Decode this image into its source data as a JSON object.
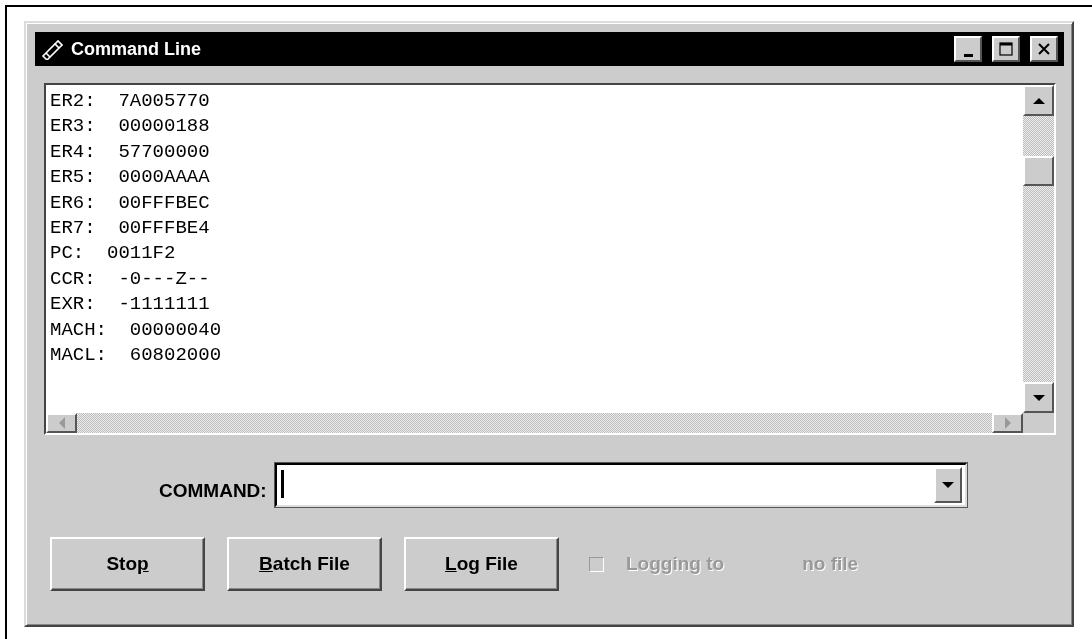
{
  "window": {
    "title": "Command Line"
  },
  "output": {
    "lines": [
      "ER2:  7A005770",
      "ER3:  00000188",
      "ER4:  57700000",
      "ER5:  0000AAAA",
      "ER6:  00FFFBEC",
      "ER7:  00FFFBE4",
      "PC:  0011F2",
      "CCR:  -0---Z--",
      "EXR:  -1111111",
      "MACH:  00000040",
      "MACL:  60802000"
    ]
  },
  "command": {
    "label": "COMMAND:"
  },
  "buttons": [
    {
      "pre": "Sto",
      "key": "p"
    },
    {
      "key": "B",
      "post": "atch File"
    },
    {
      "key": "L",
      "post": "og File"
    }
  ],
  "logging": {
    "label": "Logging to",
    "checked": false,
    "disabled": true,
    "file": "no file"
  }
}
